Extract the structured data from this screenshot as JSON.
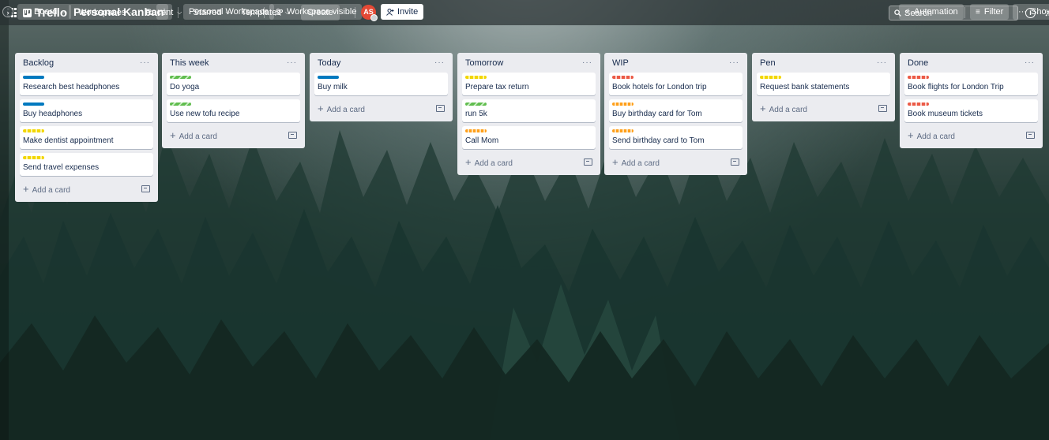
{
  "header": {
    "logo": "Trello",
    "nav": [
      {
        "label": "Workspaces"
      },
      {
        "label": "Recent"
      },
      {
        "label": "Starred"
      },
      {
        "label": "Templates"
      }
    ],
    "create_label": "Create",
    "search_placeholder": "Search"
  },
  "boardbar": {
    "view_label": "Board",
    "title": "Personal Kanban",
    "workspace_label": "Personal Workspace",
    "visibility_label": "Workspace visible",
    "avatar_initials": "AS",
    "invite_label": "Invite",
    "automation_label": "Automation",
    "filter_label": "Filter",
    "show_label": "Show"
  },
  "add_card_label": "Add a card",
  "colors": {
    "blue": "#0079bf",
    "yellow": "#f2d600",
    "green": "#61bd4f",
    "red": "#eb5a46",
    "orange": "#ff9f1a"
  },
  "lists": [
    {
      "title": "Backlog",
      "cards": [
        {
          "title": "Research best headphones",
          "labels": [
            "blue"
          ]
        },
        {
          "title": "Buy headphones",
          "labels": [
            "blue"
          ]
        },
        {
          "title": "Make dentist appointment",
          "labels": [
            "yellow"
          ]
        },
        {
          "title": "Send travel expenses",
          "labels": [
            "yellow"
          ]
        }
      ]
    },
    {
      "title": "This week",
      "cards": [
        {
          "title": "Do yoga",
          "labels": [
            "green"
          ]
        },
        {
          "title": "Use new tofu recipe",
          "labels": [
            "green"
          ]
        }
      ]
    },
    {
      "title": "Today",
      "cards": [
        {
          "title": "Buy milk",
          "labels": [
            "blue"
          ]
        }
      ]
    },
    {
      "title": "Tomorrow",
      "cards": [
        {
          "title": "Prepare tax return",
          "labels": [
            "yellow"
          ]
        },
        {
          "title": "run 5k",
          "labels": [
            "green"
          ]
        },
        {
          "title": "Call Mom",
          "labels": [
            "orange"
          ]
        }
      ]
    },
    {
      "title": "WIP",
      "cards": [
        {
          "title": "Book hotels for London trip",
          "labels": [
            "red"
          ]
        },
        {
          "title": "Buy birthday card for Tom",
          "labels": [
            "orange"
          ]
        },
        {
          "title": "Send birthday card to Tom",
          "labels": [
            "orange"
          ]
        }
      ]
    },
    {
      "title": "Pen",
      "cards": [
        {
          "title": "Request bank statements",
          "labels": [
            "yellow"
          ]
        }
      ]
    },
    {
      "title": "Done",
      "cards": [
        {
          "title": "Book flights for London Trip",
          "labels": [
            "red"
          ]
        },
        {
          "title": "Book museum tickets",
          "labels": [
            "red"
          ]
        }
      ]
    }
  ]
}
